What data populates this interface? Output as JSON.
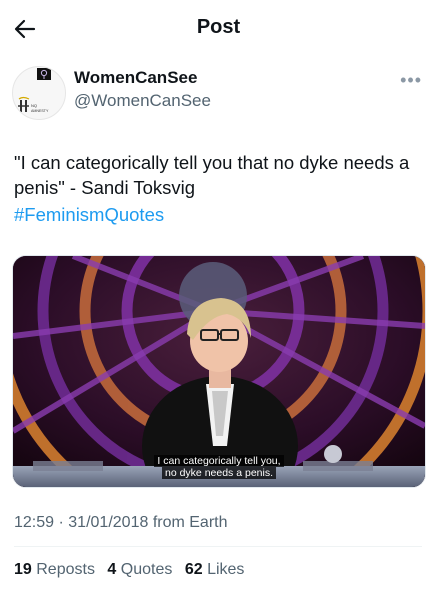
{
  "header": {
    "title": "Post"
  },
  "author": {
    "name": "WomenCanSee",
    "handle": "@WomenCanSee",
    "avatar_logo_text": "AMNESTY"
  },
  "tweet": {
    "text": "\"I can categorically tell you that no dyke needs a penis\" - Sandi Toksvig",
    "hashtag": "#FeminismQuotes"
  },
  "media": {
    "subtitle_line1": "I can categorically tell you,",
    "subtitle_line2": "no dyke needs a penis."
  },
  "meta": {
    "time": "12:59",
    "date": "31/01/2018",
    "source": "from Earth",
    "separator": "·"
  },
  "stats": {
    "reposts_count": "19",
    "reposts_label": "Reposts",
    "quotes_count": "4",
    "quotes_label": "Quotes",
    "likes_count": "62",
    "likes_label": "Likes"
  }
}
